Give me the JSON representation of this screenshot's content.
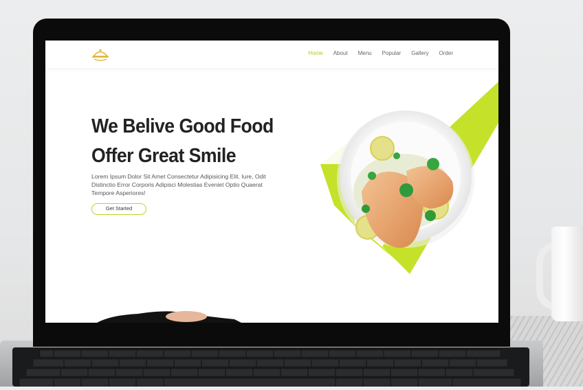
{
  "site": {
    "nav": {
      "items": [
        "Home",
        "About",
        "Menu",
        "Popular",
        "Gallery",
        "Order"
      ],
      "active_index": 0
    },
    "hero": {
      "title_line1": "We Belive Good Food",
      "title_line2": "Offer Great Smile",
      "description": "Lorem Ipsum Dolor Sit Amet Consectetur Adipisicing Elit. Iure, Odit Distinctio Error Corporis Adipisci Molestias Eveniet Optio Quaerat Tempore Asperiores!",
      "cta_label": "Get Started"
    }
  },
  "colors": {
    "accent": "#b5d92a",
    "accent_active": "#a6cf1f",
    "title": "#222222"
  },
  "icons": {
    "logo": "cloche-icon"
  }
}
